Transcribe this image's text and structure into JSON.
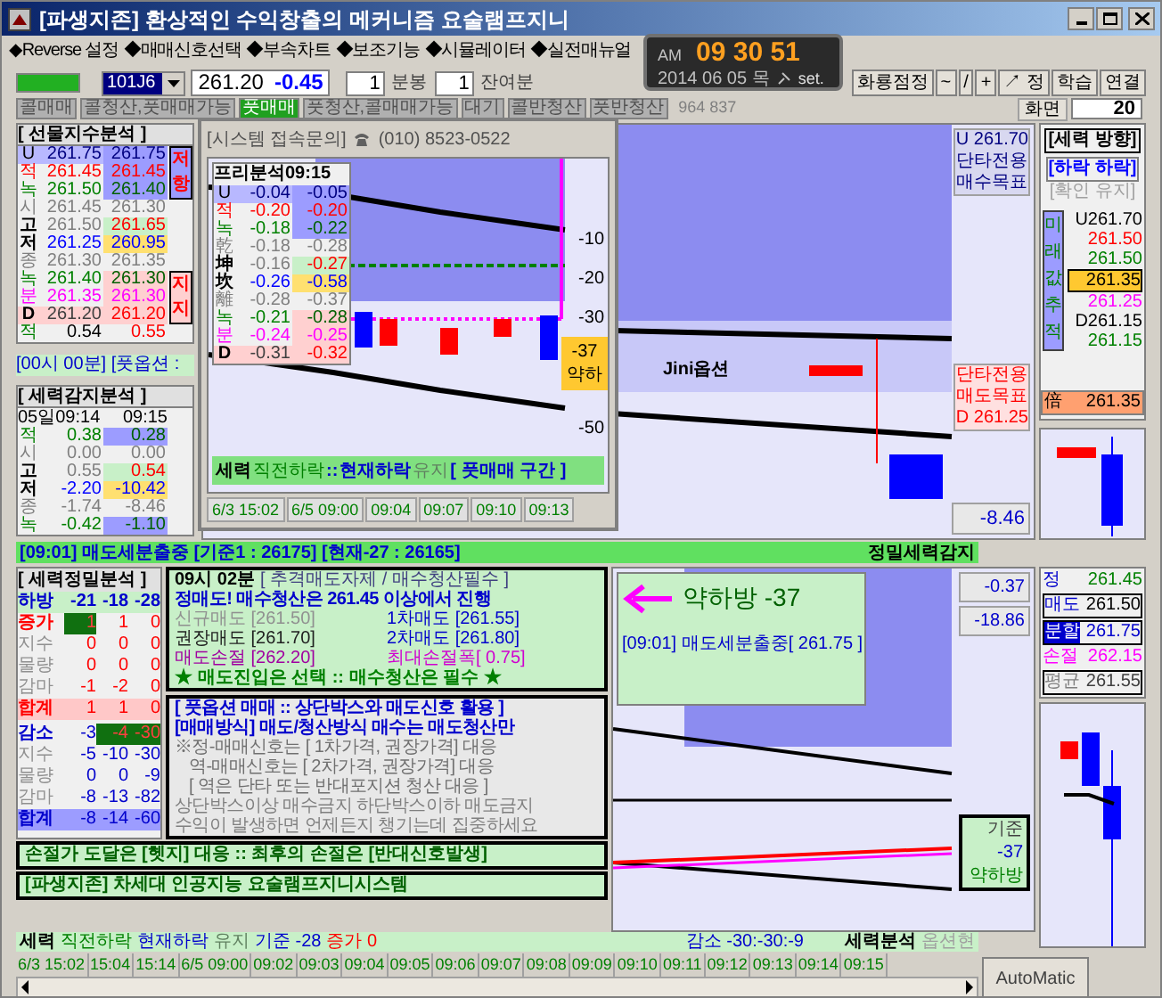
{
  "window": {
    "title": "[파생지존] 환상적인 수익창출의 메커니즘 요술램프지니"
  },
  "menu": [
    "◆Reverse 설정",
    "◆매매신호선택",
    "◆부속차트",
    "◆보조기능",
    "◆시뮬레이터",
    "◆실전매뉴얼"
  ],
  "clock": {
    "ampm": "AM",
    "time": "09 30 51",
    "date": "2014 06 05 목",
    "set": "set."
  },
  "toolbar": {
    "code": "101J6",
    "price": "261.20",
    "change": "-0.45",
    "interval": "1",
    "interval_unit": "분봉",
    "remain": "1",
    "remain_unit": "잔여분",
    "buttons": [
      "화룡점정",
      "~",
      "/",
      "+",
      "↗ 정",
      "학습",
      "연결"
    ],
    "screen_label": "화면",
    "screen_value": "20"
  },
  "modes": [
    {
      "label": "콜매매",
      "selected": false
    },
    {
      "label": "콜청산,풋매매가능",
      "selected": false
    },
    {
      "label": "풋매매",
      "selected": true
    },
    {
      "label": "풋청산,콜매매가능",
      "selected": false
    },
    {
      "label": "대기",
      "selected": false
    },
    {
      "label": "콜반청산",
      "selected": false
    },
    {
      "label": "풋반청산",
      "selected": false
    }
  ],
  "mode_counter": "964 837",
  "futures_panel": {
    "title": "[ 선물지수분석 ]",
    "resistance": "저항",
    "support": "지지",
    "rows": [
      {
        "label": "U",
        "v1": "261.75",
        "v2": "261.75",
        "kind": "u"
      },
      {
        "label": "적",
        "v1": "261.45",
        "v2": "261.45",
        "kind": "red"
      },
      {
        "label": "녹",
        "v1": "261.50",
        "v2": "261.40",
        "kind": "green"
      },
      {
        "label": "시",
        "v1": "261.45",
        "v2": "261.30",
        "kind": "gray"
      },
      {
        "label": "고",
        "v1": "261.50",
        "v2": "261.65",
        "kind": "high"
      },
      {
        "label": "저",
        "v1": "261.25",
        "v2": "260.95",
        "kind": "low"
      },
      {
        "label": "종",
        "v1": "261.30",
        "v2": "261.35",
        "kind": "gray"
      },
      {
        "label": "녹",
        "v1": "261.40",
        "v2": "261.30",
        "kind": "green2"
      },
      {
        "label": "분",
        "v1": "261.35",
        "v2": "261.30",
        "kind": "magenta"
      },
      {
        "label": "D",
        "v1": "261.20",
        "v2": "261.20",
        "kind": "d"
      },
      {
        "label": "적",
        "v1": "0.54",
        "v2": "0.55",
        "kind": "black"
      }
    ]
  },
  "ticker_bar": "[00시 00분] [풋옵션 :",
  "force_panel": {
    "title": "[ 세력감지분석 ]",
    "header": [
      "05일09:14",
      "09:15"
    ],
    "rows": [
      {
        "label": "적",
        "v1": "0.38",
        "v2": "0.28",
        "kind": "green"
      },
      {
        "label": "시",
        "v1": "0.00",
        "v2": "0.00",
        "kind": "gray"
      },
      {
        "label": "고",
        "v1": "0.55",
        "v2": "0.54",
        "kind": "high"
      },
      {
        "label": "저",
        "v1": "-2.20",
        "v2": "-10.42",
        "kind": "low"
      },
      {
        "label": "종",
        "v1": "-1.74",
        "v2": "-8.46",
        "kind": "gray"
      },
      {
        "label": "녹",
        "v1": "-0.42",
        "v2": "-1.10",
        "kind": "green"
      }
    ]
  },
  "popup": {
    "title": "[시스템 접속문의]",
    "phone": "(010) 8523-0522",
    "table_title": "프리분석09:15",
    "rows": [
      {
        "label": "U",
        "v1": "-0.04",
        "v2": "-0.05",
        "kind": "u"
      },
      {
        "label": "적",
        "v1": "-0.20",
        "v2": "-0.20",
        "kind": "red"
      },
      {
        "label": "녹",
        "v1": "-0.18",
        "v2": "-0.22",
        "kind": "green"
      },
      {
        "label": "乾",
        "v1": "-0.18",
        "v2": "-0.28",
        "kind": "gray"
      },
      {
        "label": "坤",
        "v1": "-0.16",
        "v2": "-0.27",
        "kind": "high"
      },
      {
        "label": "坎",
        "v1": "-0.26",
        "v2": "-0.58",
        "kind": "low"
      },
      {
        "label": "離",
        "v1": "-0.28",
        "v2": "-0.37",
        "kind": "gray"
      },
      {
        "label": "녹",
        "v1": "-0.21",
        "v2": "-0.28",
        "kind": "green2"
      },
      {
        "label": "분",
        "v1": "-0.24",
        "v2": "-0.25",
        "kind": "magenta"
      },
      {
        "label": "D",
        "v1": "-0.31",
        "v2": "-0.32",
        "kind": "d"
      }
    ],
    "axis": [
      "-10",
      "-20",
      "-30",
      "-50"
    ],
    "badge_value": "-37",
    "badge_state": "약하",
    "status": [
      {
        "text": "세력",
        "kind": "label"
      },
      {
        "text": "직전하락",
        "kind": "trend"
      },
      {
        "text": "::",
        "kind": "state"
      },
      {
        "text": "현재하락",
        "kind": "state"
      },
      {
        "text": "유지",
        "kind": "plain"
      },
      {
        "text": "[ 풋매매 구간 ]",
        "kind": "state"
      }
    ],
    "times": [
      "6/3 15:02",
      "6/5 09:00",
      "09:04",
      "09:07",
      "09:10",
      "09:13"
    ]
  },
  "chart": {
    "buy_target": [
      "U 261.70",
      "단타전용",
      "매수목표"
    ],
    "sell_target": [
      "단타전용",
      "매도목표",
      "D 261.25"
    ],
    "legend": "Jini옵션",
    "value_box": "-8.46"
  },
  "direction_panel": {
    "title": "[세력 방향]",
    "line1": "[하락 하락]",
    "line2": "[확인 유지]",
    "vertical": "미래값추적",
    "values": [
      {
        "text": "U261.70",
        "kind": "plain"
      },
      {
        "text": "261.50",
        "kind": "red"
      },
      {
        "text": "261.50",
        "kind": "green"
      },
      {
        "text": "261.35",
        "kind": "current"
      },
      {
        "text": "261.25",
        "kind": "magenta"
      },
      {
        "text": "D261.15",
        "kind": "plain"
      },
      {
        "text": "261.15",
        "kind": "green"
      }
    ],
    "result_label": "倍",
    "result_value": "261.35"
  },
  "signal_bar": {
    "text": "[09:01] 매도세분출중 [기준1 : 26175] [현재-27 : 26165]",
    "right": "정밀세력감지"
  },
  "precision_panel": {
    "title": "[ 세력정밀분석 ]",
    "header": [
      "하방",
      "-21",
      "-18",
      "-28"
    ],
    "rows": [
      {
        "label": "증가",
        "kind": "up",
        "values": [
          {
            "text": "1",
            "highlight": true
          },
          {
            "text": "1",
            "highlight": false
          },
          {
            "text": "0",
            "highlight": false
          }
        ]
      },
      {
        "label": "지수",
        "kind": "up_item",
        "values": [
          {
            "text": "0",
            "highlight": false
          },
          {
            "text": "0",
            "highlight": false
          },
          {
            "text": "0",
            "highlight": false
          }
        ]
      },
      {
        "label": "물량",
        "kind": "up_item",
        "values": [
          {
            "text": "0",
            "highlight": false
          },
          {
            "text": "0",
            "highlight": false
          },
          {
            "text": "0",
            "highlight": false
          }
        ]
      },
      {
        "label": "감마",
        "kind": "up_item",
        "values": [
          {
            "text": "-1",
            "highlight": false
          },
          {
            "text": "-2",
            "highlight": false
          },
          {
            "text": "0",
            "highlight": false
          }
        ]
      },
      {
        "label": "합계",
        "kind": "up_total",
        "values": [
          {
            "text": "1",
            "highlight": false
          },
          {
            "text": "1",
            "highlight": false
          },
          {
            "text": "0",
            "highlight": false
          }
        ]
      },
      {
        "label": "감소",
        "kind": "down",
        "values": [
          {
            "text": "-3",
            "highlight": false
          },
          {
            "text": "-4",
            "highlight": true
          },
          {
            "text": "-30",
            "highlight": true
          }
        ]
      },
      {
        "label": "지수",
        "kind": "down_item",
        "values": [
          {
            "text": "-5",
            "highlight": false
          },
          {
            "text": "-10",
            "highlight": false
          },
          {
            "text": "-30",
            "highlight": false
          }
        ]
      },
      {
        "label": "물량",
        "kind": "down_item",
        "values": [
          {
            "text": "0",
            "highlight": false
          },
          {
            "text": "0",
            "highlight": false
          },
          {
            "text": "-9",
            "highlight": false
          }
        ]
      },
      {
        "label": "감마",
        "kind": "down_item",
        "values": [
          {
            "text": "-8",
            "highlight": false
          },
          {
            "text": "-13",
            "highlight": false
          },
          {
            "text": "-82",
            "highlight": false
          }
        ]
      },
      {
        "label": "합계",
        "kind": "down_total",
        "values": [
          {
            "text": "-8",
            "highlight": false
          },
          {
            "text": "-14",
            "highlight": false
          },
          {
            "text": "-60",
            "highlight": false
          }
        ]
      }
    ]
  },
  "plan_box": {
    "time": "09시 02분",
    "headline": "[ 추격매도자제 / 매수청산필수 ]",
    "instruction": "정매도! 매수청산은 261.45 이상에서 진행",
    "prices": [
      {
        "text": "신규매도 [261.50]",
        "kind": "muted"
      },
      {
        "text": "1차매도 [261.55]",
        "kind": "blue"
      },
      {
        "text": "권장매도 [261.70]",
        "kind": "dark"
      },
      {
        "text": "2차매도 [261.80]",
        "kind": "blue"
      },
      {
        "text": "매도손절 [262.20]",
        "kind": "purple"
      },
      {
        "text": "최대손절폭[ 0.75]",
        "kind": "magenta"
      }
    ],
    "rule": "★ 매도진입은 선택 :: 매수청산은 필수 ★"
  },
  "strategy_box": {
    "lines": [
      {
        "text": "[ 풋옵션 매매 :: 상단박스와 매도신호 활용 ]",
        "kind": "title"
      },
      {
        "text": "[매매방식] 매도/청산방식 매수는 매도청산만",
        "kind": "title"
      },
      {
        "text": "※정-매매신호는 [ 1차가격, 권장가격] 대응",
        "kind": "note"
      },
      {
        "text": "역-매매신호는 [ 2차가격, 권장가격] 대응",
        "kind": "note_indent"
      },
      {
        "text": "[ 역은 단타 또는 반대포지션 청산 대응 ]",
        "kind": "note_indent"
      },
      {
        "text": "상단박스이상 매수금지  하단박스이하 매도금지",
        "kind": "plain"
      },
      {
        "text": "수익이 발생하면 언제든지 챙기는데 집중하세요",
        "kind": "plain"
      }
    ]
  },
  "stop_line": "손절가 도달은 [헷지] 대응 :: 최후의 손절은 [반대신호발생]",
  "brand_line": "[파생지존] 차세대 인공지능 요술램프지니시스템",
  "overlay": {
    "signal": "약하방 -37",
    "entry": "[09:01] 매도세분출중[ 261.75 ]"
  },
  "readings": [
    "-0.37",
    "-18.86"
  ],
  "orders": [
    {
      "label": "정",
      "value": "261.45",
      "kind": "entry"
    },
    {
      "label": "매도",
      "value": "261.50",
      "kind": "sell"
    },
    {
      "label": "분할",
      "value": "261.75",
      "kind": "split"
    },
    {
      "label": "손절",
      "value": "262.15",
      "kind": "stop"
    },
    {
      "label": "평균",
      "value": "261.55",
      "kind": "avg"
    }
  ],
  "gauge": {
    "label": "기준",
    "value": "-37",
    "state": "약하방"
  },
  "chart_labels": [
    "세력분석",
    "옵션현"
  ],
  "footer": [
    {
      "text": "세력",
      "kind": "label"
    },
    {
      "text": "직전하락",
      "kind": "trend"
    },
    {
      "text": "현재하락",
      "kind": "state"
    },
    {
      "text": "유지",
      "kind": "plain"
    },
    {
      "text": "기준 -28",
      "kind": "state"
    },
    {
      "text": "증가 0",
      "kind": "increase"
    },
    {
      "text": "감소 -30:-30:-9",
      "kind": "state"
    }
  ],
  "times": [
    "6/3 15:02",
    "15:04",
    "15:14",
    "6/5 09:00",
    "09:02",
    "09:03",
    "09:04",
    "09:05",
    "09:06",
    "09:07",
    "09:08",
    "09:09",
    "09:10",
    "09:11",
    "09:12",
    "09:13",
    "09:14",
    "09:15"
  ],
  "auto_button": "AutoMatic"
}
